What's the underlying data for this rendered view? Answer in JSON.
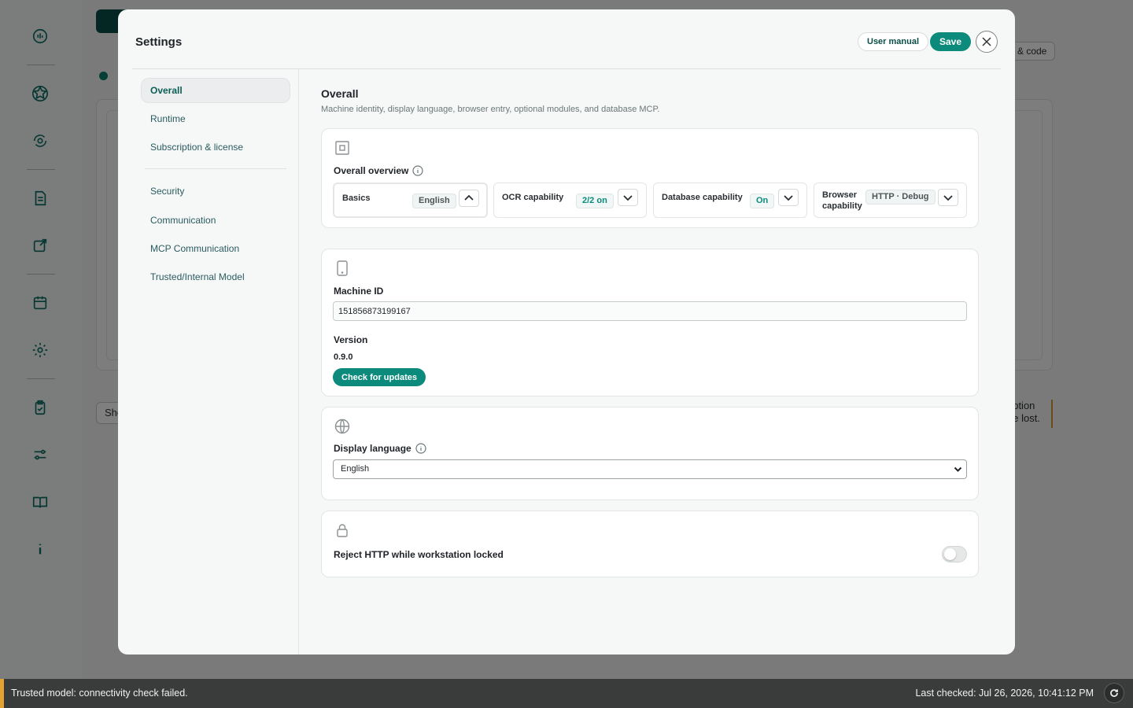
{
  "background": {
    "pill_label": "& code",
    "show_button_label": "Sho",
    "note_lines": [
      "ription",
      "be lost."
    ]
  },
  "modal": {
    "title": "Settings",
    "user_manual_label": "User manual",
    "save_label": "Save"
  },
  "sidebar": {
    "items": [
      {
        "label": "Overall",
        "active": true
      },
      {
        "label": "Runtime"
      },
      {
        "label": "Subscription & license"
      },
      {
        "label": "Security"
      },
      {
        "label": "Communication"
      },
      {
        "label": "MCP Communication"
      },
      {
        "label": "Trusted/Internal Model"
      }
    ]
  },
  "content": {
    "title": "Overall",
    "subtitle": "Machine identity, display language, browser entry, optional modules, and database MCP.",
    "overview": {
      "label": "Overall overview",
      "items": [
        {
          "name": "Basics",
          "badge": "English",
          "expanded": true
        },
        {
          "name": "OCR capability",
          "badge": "2/2 on",
          "expanded": false
        },
        {
          "name": "Database capability",
          "badge": "On",
          "expanded": false
        },
        {
          "name": "Browser capability",
          "name_line1": "Browser",
          "name_line2": "capability",
          "badge": "HTTP · Debug",
          "expanded": false
        }
      ]
    },
    "machine": {
      "label": "Machine ID",
      "value": "151856873199167",
      "version_label": "Version",
      "version_value": "0.9.0",
      "update_button": "Check for updates"
    },
    "language": {
      "label": "Display language",
      "selected": "English"
    },
    "lock": {
      "label": "Reject HTTP while workstation locked",
      "enabled": false
    }
  },
  "statusbar": {
    "message": "Trusted model: connectivity check failed.",
    "last_checked": "Last checked: Jul 26, 2026, 10:41:12 PM"
  },
  "colors": {
    "accent": "#0c8a7b",
    "warning": "#e4a332"
  }
}
